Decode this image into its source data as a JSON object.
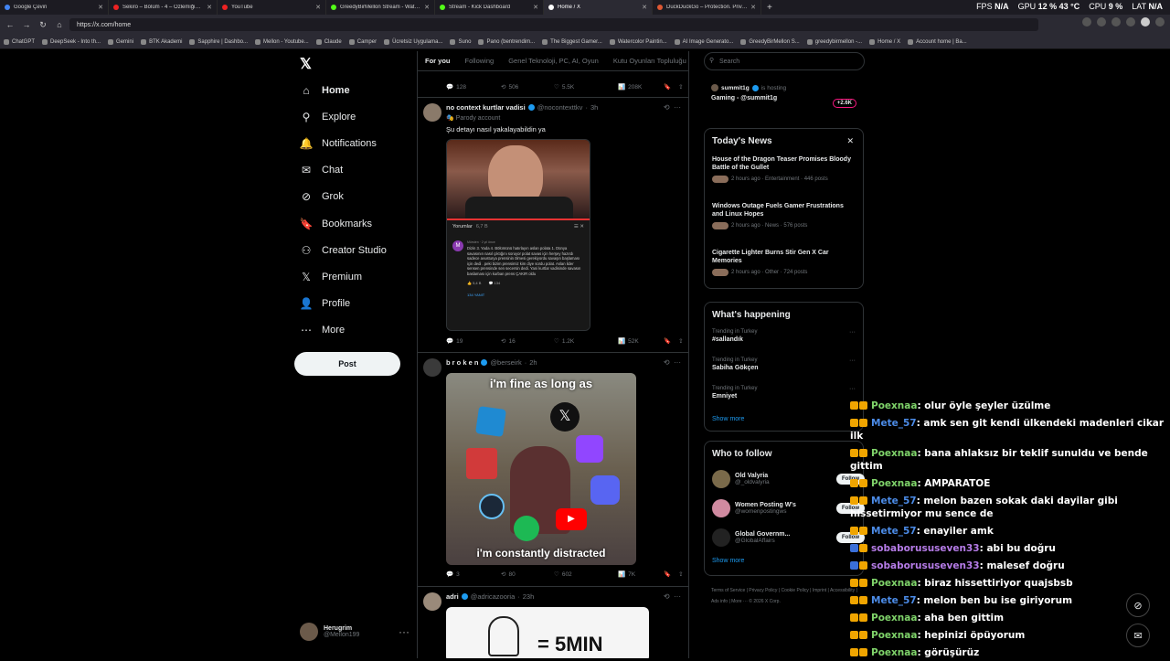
{
  "tabs": [
    {
      "label": "Google Çeviri",
      "color": "#4285f4"
    },
    {
      "label": "Sekiro – Bölüm - 4 – Özlemiğim !!!",
      "color": "#e22"
    },
    {
      "label": "YouTube",
      "color": "#e22"
    },
    {
      "label": "GreedyBirMellon Stream - Watch Li",
      "color": "#53fc18"
    },
    {
      "label": "Stream - Kick Dashboard",
      "color": "#53fc18"
    },
    {
      "label": "Home / X",
      "color": "#fff"
    },
    {
      "label": "DuckDuckGo – Protection. Privacy.",
      "color": "#de5833"
    }
  ],
  "perf": {
    "fps_label": "FPS",
    "fps_value": "N/A",
    "gpu_label": "GPU",
    "gpu_value": "12 % 43 °C",
    "cpu_label": "CPU",
    "cpu_value": "9 %",
    "lat_label": "LAT",
    "lat_value": "N/A"
  },
  "url": "https://x.com/home",
  "bookmarks": [
    "ChatGPT",
    "DeepSeek - Into th...",
    "Gemini",
    "BTK Akademi",
    "Sapphire | Dashbo...",
    "Mellon - Youtube...",
    "Claude",
    "Camper",
    "Ücretsiz Uygulama...",
    "Suno",
    "Pano (bentrendim...",
    "The Biggest Gamer...",
    "Watercolor Paintin...",
    "AI Image Generato...",
    "GreedyBirMellon S...",
    "greedybirmellon -...",
    "Home / X",
    "Account home | Ba..."
  ],
  "nav": {
    "items": [
      "Home",
      "Explore",
      "Notifications",
      "Chat",
      "Grok",
      "Bookmarks",
      "Creator Studio",
      "Premium",
      "Profile",
      "More"
    ],
    "post_label": "Post",
    "user_name": "Herugrim",
    "user_handle": "@Mellon199"
  },
  "feed": {
    "tabs": [
      "For you",
      "Following",
      "Genel Teknoloji, PC, AI, Oyun",
      "Kutu Oyunları Topluluğu"
    ],
    "top_actions": {
      "replies": "128",
      "reposts": "506",
      "likes": "5.5K",
      "views": "208K"
    },
    "post1": {
      "name": "no context kurtlar vadisi",
      "handle": "@nocontexttkv",
      "time": "3h",
      "label": "Parody account",
      "text": "Şu detayı nasıl yakalayabildin ya",
      "yt_header": "Yorumlar",
      "yt_count": "6,7 B",
      "yt_user": "Mürsten · 2 yıl önce",
      "yt_comment": "Dizin 3. Yada 4. Bölümünü hatırlayın aslan polata 1. Dünya savasının nasıl çıktığını soruyor polat savas için herşey hazırdı sadece avusturya prensinin ölmesi gerekiyordu savaşın başlaması için dedi . peki bizim prensimiz kim diye sordu polat. Aslan lider sensen prensinde sen secersin dedi. Yani kurtlar vadisinde savasın baslaması için kurban prens ÇAKIR oldu",
      "yt_likes": "5,4 B",
      "yt_replies": "134",
      "yt_reply_link": "134 YANIT",
      "actions": {
        "replies": "19",
        "reposts": "16",
        "likes": "1.2K",
        "views": "52K"
      }
    },
    "post2": {
      "name": "b r o k e n",
      "handle": "@berseirk",
      "time": "2h",
      "meme_top": "i'm fine as long as",
      "meme_bottom": "i'm constantly distracted",
      "actions": {
        "replies": "3",
        "reposts": "80",
        "likes": "602",
        "views": "7K"
      }
    },
    "post3": {
      "name": "adri",
      "handle": "@adricazooria",
      "time": "23h",
      "img_text": "= 5MIN"
    }
  },
  "right": {
    "search_placeholder": "Search",
    "live": {
      "user": "summit1g",
      "status": "is hosting",
      "title": "Gaming - @summit1g",
      "count": "+2.6K"
    },
    "news": {
      "title": "Today's News",
      "items": [
        {
          "title": "House of the Dragon Teaser Promises Bloody Battle of the Gullet",
          "meta": "2 hours ago · Entertainment · 446 posts"
        },
        {
          "title": "Windows Outage Fuels Gamer Frustrations and Linux Hopes",
          "meta": "2 hours ago · News · 576 posts"
        },
        {
          "title": "Cigarette Lighter Burns Stir Gen X Car Memories",
          "meta": "2 hours ago · Other · 724 posts"
        }
      ]
    },
    "happening": {
      "title": "What's happening",
      "items": [
        {
          "context": "Trending in Turkey",
          "tag": "#sallandık"
        },
        {
          "context": "Trending in Turkey",
          "tag": "Sabiha Gökçen"
        },
        {
          "context": "Trending in Turkey",
          "tag": "Emniyet"
        }
      ],
      "show_more": "Show more"
    },
    "follow": {
      "title": "Who to follow",
      "items": [
        {
          "name": "Old Valyria",
          "handle": "@_oldvalyria",
          "btn": "Follow"
        },
        {
          "name": "Women Posting W's",
          "handle": "@womenpostingws",
          "btn": "Follow"
        },
        {
          "name": "Global Governm...",
          "handle": "@GlobalAffairs",
          "btn": "Follow"
        }
      ],
      "show_more": "Show more"
    },
    "footer": "Terms of Service | Privacy Policy | Cookie Policy | Imprint | Accessibility | Ads info | More ··· © 2026 X Corp."
  },
  "chat": [
    {
      "user": "Poexnaa",
      "color": "#7fd36a",
      "badge": "y",
      "msg": ": olur öyle şeyler üzülme"
    },
    {
      "user": "Mete_57",
      "color": "#4c8ce8",
      "badge": "y",
      "msg": ": amk sen git kendi ülkendeki madenleri cikar ilk"
    },
    {
      "user": "Poexnaa",
      "color": "#7fd36a",
      "badge": "y",
      "msg": ": bana ahlaksız bir teklif sunuldu ve bende gittim"
    },
    {
      "user": "Poexnaa",
      "color": "#7fd36a",
      "badge": "y",
      "msg": ": AMPARATOE"
    },
    {
      "user": "Mete_57",
      "color": "#4c8ce8",
      "badge": "y",
      "msg": ": melon bazen sokak daki dayilar gibi hissetirmiyor mu sence de"
    },
    {
      "user": "Mete_57",
      "color": "#4c8ce8",
      "badge": "y",
      "msg": ": enayiler amk"
    },
    {
      "user": "sobaborususeven33",
      "color": "#b67ce8",
      "badge": "b",
      "msg": ": abi bu doğru"
    },
    {
      "user": "sobaborususeven33",
      "color": "#b67ce8",
      "badge": "b",
      "msg": ": malesef doğru"
    },
    {
      "user": "Poexnaa",
      "color": "#7fd36a",
      "badge": "y",
      "msg": ": biraz hissettiriyor quajsbsb"
    },
    {
      "user": "Mete_57",
      "color": "#4c8ce8",
      "badge": "y",
      "msg": ": melon ben bu ise giriyorum"
    },
    {
      "user": "Poexnaa",
      "color": "#7fd36a",
      "badge": "y",
      "msg": ": aha ben gittim"
    },
    {
      "user": "Poexnaa",
      "color": "#7fd36a",
      "badge": "y",
      "msg": ": hepinizi öpüyorum"
    },
    {
      "user": "Poexnaa",
      "color": "#7fd36a",
      "badge": "y",
      "msg": ": görüşürüz"
    }
  ]
}
